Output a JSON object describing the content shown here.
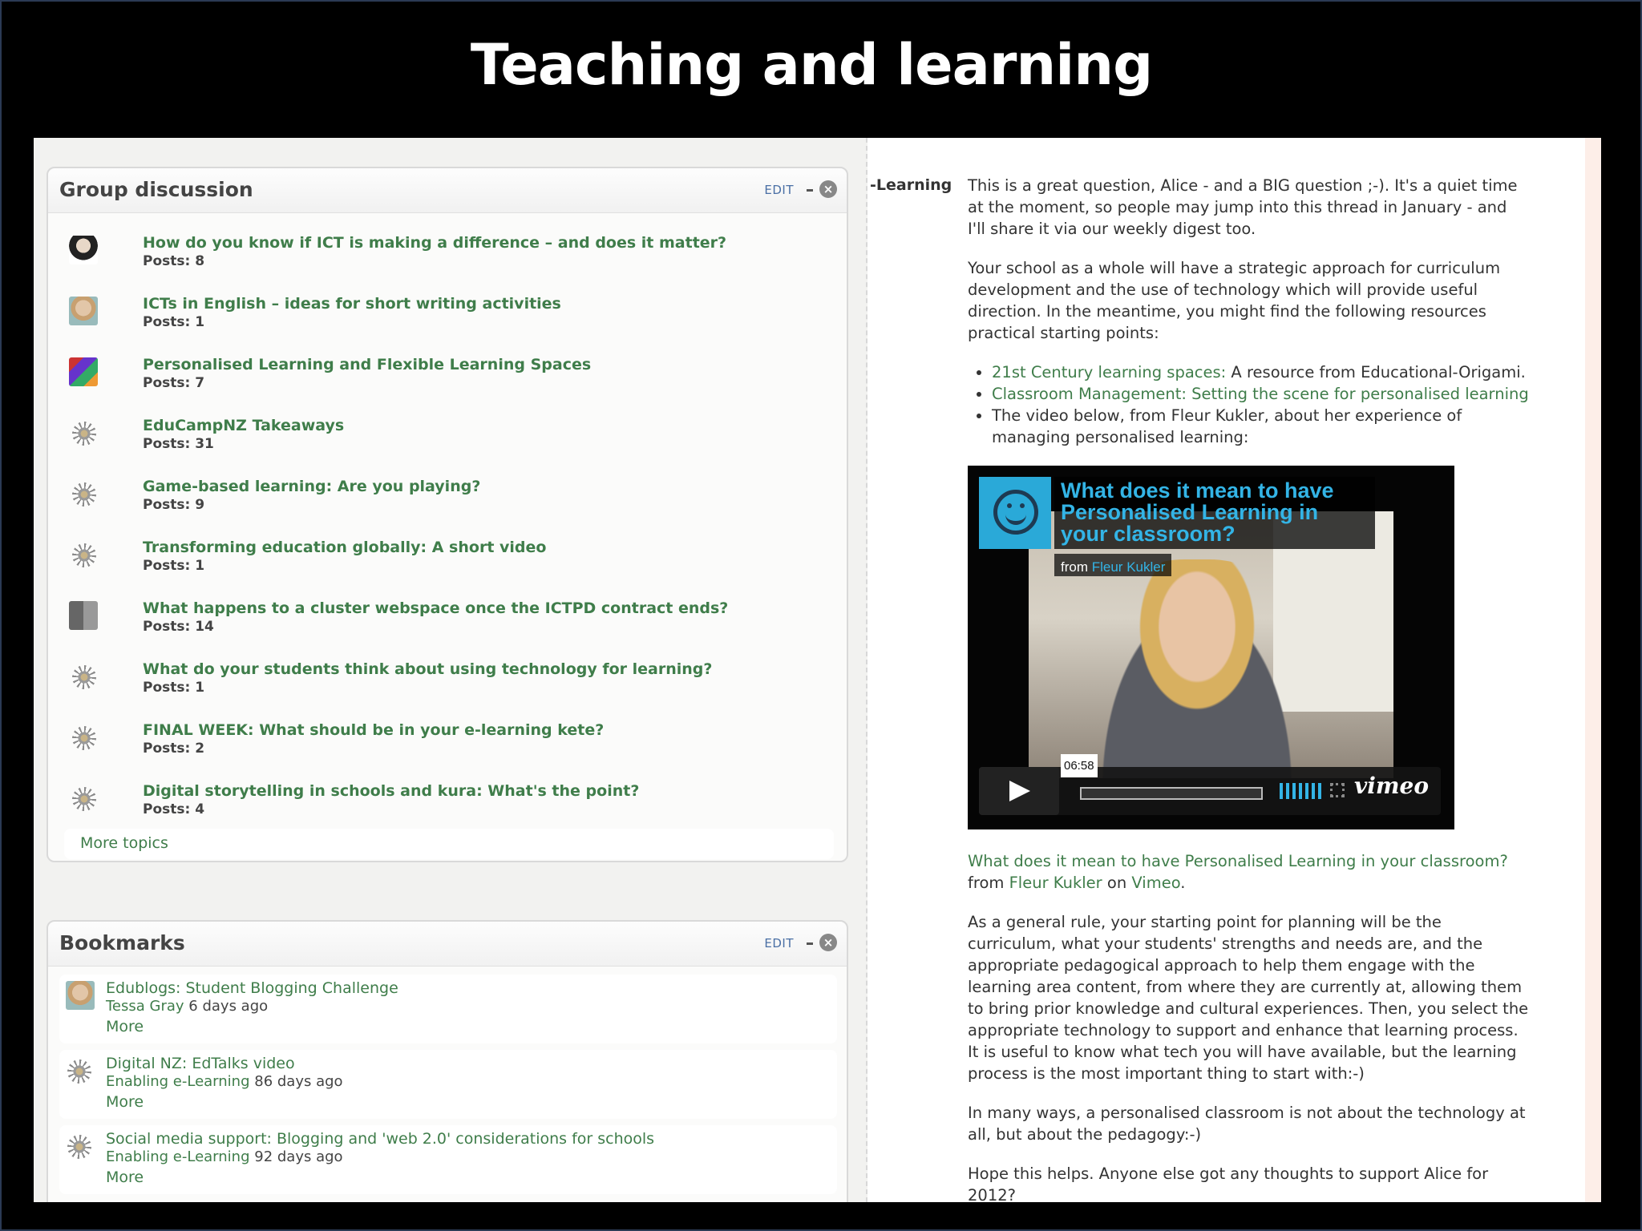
{
  "slide": {
    "title": "Teaching and learning"
  },
  "group_discussion": {
    "title": "Group discussion",
    "edit_label": "EDIT",
    "close_glyph": "×",
    "topics": [
      {
        "title": "How do you know if ICT is making a difference – and does it matter?",
        "posts": "Posts: 8",
        "avatar": "photo1"
      },
      {
        "title": "ICTs in English – ideas for short writing activities",
        "posts": "Posts: 1",
        "avatar": "photo2"
      },
      {
        "title": "Personalised Learning and Flexible Learning Spaces",
        "posts": "Posts: 7",
        "avatar": "photo3"
      },
      {
        "title": "EduCampNZ Takeaways",
        "posts": "Posts: 31",
        "avatar": "spark"
      },
      {
        "title": "Game-based learning: Are you playing?",
        "posts": "Posts: 9",
        "avatar": "spark"
      },
      {
        "title": "Transforming education globally: A short video",
        "posts": "Posts: 1",
        "avatar": "spark"
      },
      {
        "title": "What happens to a cluster webspace once the ICTPD contract ends?",
        "posts": "Posts: 14",
        "avatar": "photo4"
      },
      {
        "title": "What do your students think about using technology for learning?",
        "posts": "Posts: 1",
        "avatar": "spark"
      },
      {
        "title": "FINAL WEEK: What should be in your e-learning kete?",
        "posts": "Posts: 2",
        "avatar": "spark"
      },
      {
        "title": "Digital storytelling in schools and kura: What's the point?",
        "posts": "Posts: 4",
        "avatar": "spark"
      }
    ],
    "more_topics": "More topics"
  },
  "bookmarks": {
    "title": "Bookmarks",
    "edit_label": "EDIT",
    "close_glyph": "×",
    "items": [
      {
        "title": "Edublogs: Student Blogging Challenge",
        "who": "Tessa Gray",
        "when": "6 days ago",
        "more": "More",
        "avatar": "photo2"
      },
      {
        "title": "Digital NZ: EdTalks video",
        "who": "Enabling e-Learning",
        "when": "86 days ago",
        "more": "More",
        "avatar": "spark"
      },
      {
        "title": "Social media support: Blogging and 'web 2.0' considerations for schools",
        "who": "Enabling e-Learning",
        "when": "92 days ago",
        "more": "More",
        "avatar": "spark"
      }
    ]
  },
  "post": {
    "author_label": "-Learning",
    "p1": "This is a great question, Alice - and a BIG question ;-). It's a quiet time at the moment, so people may jump into this thread in January - and I'll share it via our weekly digest too.",
    "p2": "Your school as a whole will have a strategic approach for curriculum development and the use of technology which will provide useful direction. In the meantime, you might find the following resources practical starting points:",
    "list": {
      "item1_link": "21st Century learning spaces:",
      "item1_text": " A resource from Educational-Origami.",
      "item2_link": "Classroom Management: Setting the scene for personalised learning",
      "item3_text": "The video below, from Fleur Kukler, about her experience of managing personalised learning:"
    },
    "video": {
      "title": "What does it mean to have Personalised Learning in your classroom?",
      "from_label": "from ",
      "author": "Fleur Kukler",
      "timecode": "06:58",
      "logo": "vimeo"
    },
    "caption": {
      "link": "What does it mean to have Personalised Learning in your classroom?",
      "from": "from ",
      "author": "Fleur Kukler",
      "on": " on ",
      "site": "Vimeo",
      "end": "."
    },
    "p3": "As a general rule, your starting point for planning will be the curriculum, what your students' strengths and needs are, and the appropriate pedagogical approach to help them engage with the learning area content, from where they are currently at, allowing them to bring prior knowledge and cultural experiences. Then, you select the appropriate technology to support and enhance that learning process. It is useful to know what tech you will have available, but the learning process is the most important thing to start with:-)",
    "p4": "In many ways, a personalised classroom is not about the technology at all, but about the pedagogy:-)",
    "p5": "Hope this helps. Anyone else got any thoughts to support Alice for 2012?"
  }
}
